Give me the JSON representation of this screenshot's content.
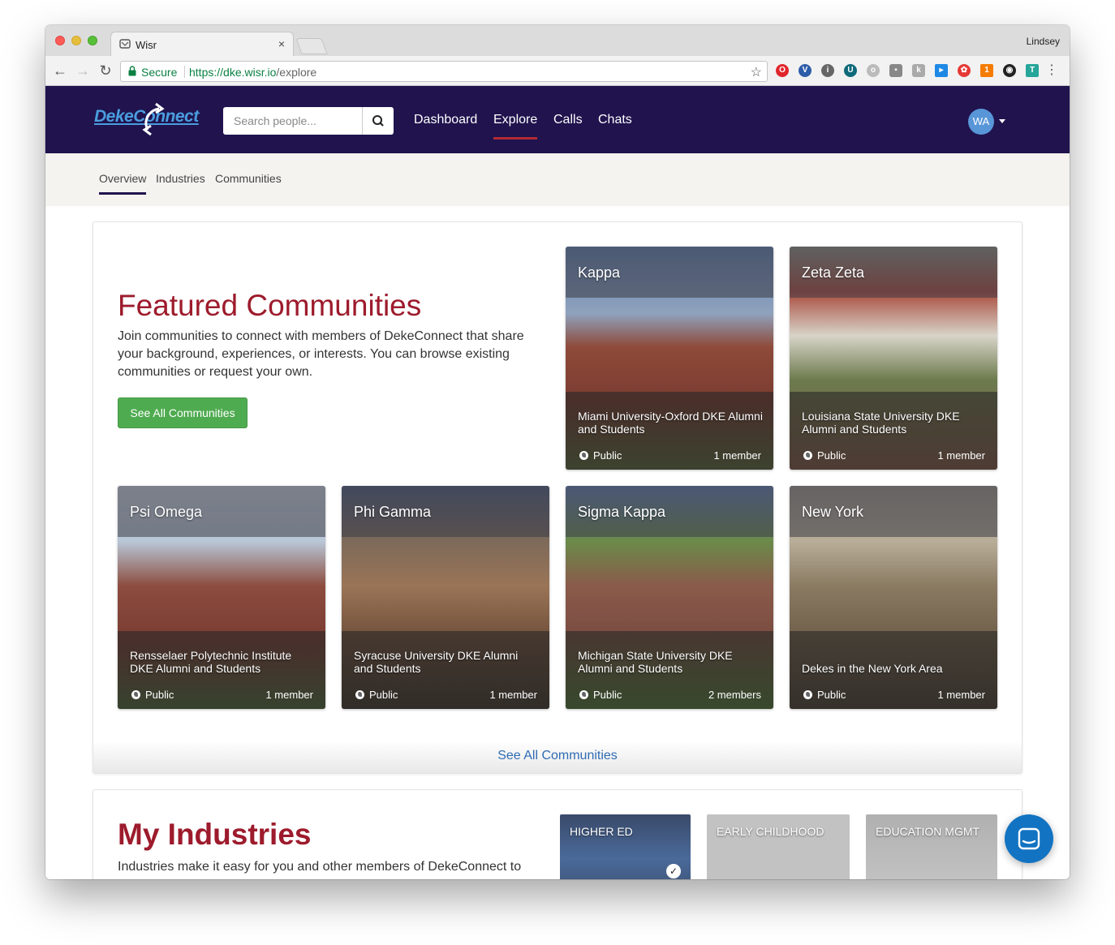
{
  "browser": {
    "tab_title": "Wisr",
    "profile_name": "Lindsey",
    "secure_label": "Secure",
    "url_scheme": "https://",
    "url_host": "dke.wisr.io",
    "url_path": "/explore"
  },
  "app": {
    "logo_text": "DekeConnect",
    "search_placeholder": "Search people...",
    "nav": [
      {
        "label": "Dashboard"
      },
      {
        "label": "Explore",
        "active": true
      },
      {
        "label": "Calls"
      },
      {
        "label": "Chats"
      }
    ],
    "avatar_initials": "WA"
  },
  "subnav": {
    "items": [
      {
        "label": "Overview",
        "active": true
      },
      {
        "label": "Industries"
      },
      {
        "label": "Communities"
      }
    ]
  },
  "featured": {
    "title": "Featured Communities",
    "description": "Join communities to connect with members of DekeConnect that share your background, experiences, or interests. You can browse existing communities or request your own.",
    "button_label": "See All Communities",
    "footer_link": "See All Communities",
    "communities": [
      {
        "name": "Kappa",
        "description": "Miami University-Oxford DKE Alumni and Students",
        "privacy": "Public",
        "members": "1 member"
      },
      {
        "name": "Zeta Zeta",
        "description": "Louisiana State University DKE Alumni and Students",
        "privacy": "Public",
        "members": "1 member"
      },
      {
        "name": "Psi Omega",
        "description": "Rensselaer Polytechnic Institute DKE Alumni and Students",
        "privacy": "Public",
        "members": "1 member"
      },
      {
        "name": "Phi Gamma",
        "description": "Syracuse University DKE Alumni and Students",
        "privacy": "Public",
        "members": "1 member"
      },
      {
        "name": "Sigma Kappa",
        "description": "Michigan State University DKE Alumni and Students",
        "privacy": "Public",
        "members": "2 members"
      },
      {
        "name": "New York",
        "description": "Dekes in the New York Area",
        "privacy": "Public",
        "members": "1 member"
      }
    ]
  },
  "industries": {
    "title": "My Industries",
    "description": "Industries make it easy for you and other members of DekeConnect to",
    "items": [
      {
        "label": "HIGHER ED",
        "selected": true
      },
      {
        "label": "EARLY CHILDHOOD"
      },
      {
        "label": "EDUCATION MGMT"
      }
    ]
  },
  "colors": {
    "app_bar": "#20134e",
    "accent_red": "#9d1b2c",
    "button_green": "#4fab50",
    "link_blue": "#2f6bb3",
    "chat_blue": "#1273c2"
  }
}
